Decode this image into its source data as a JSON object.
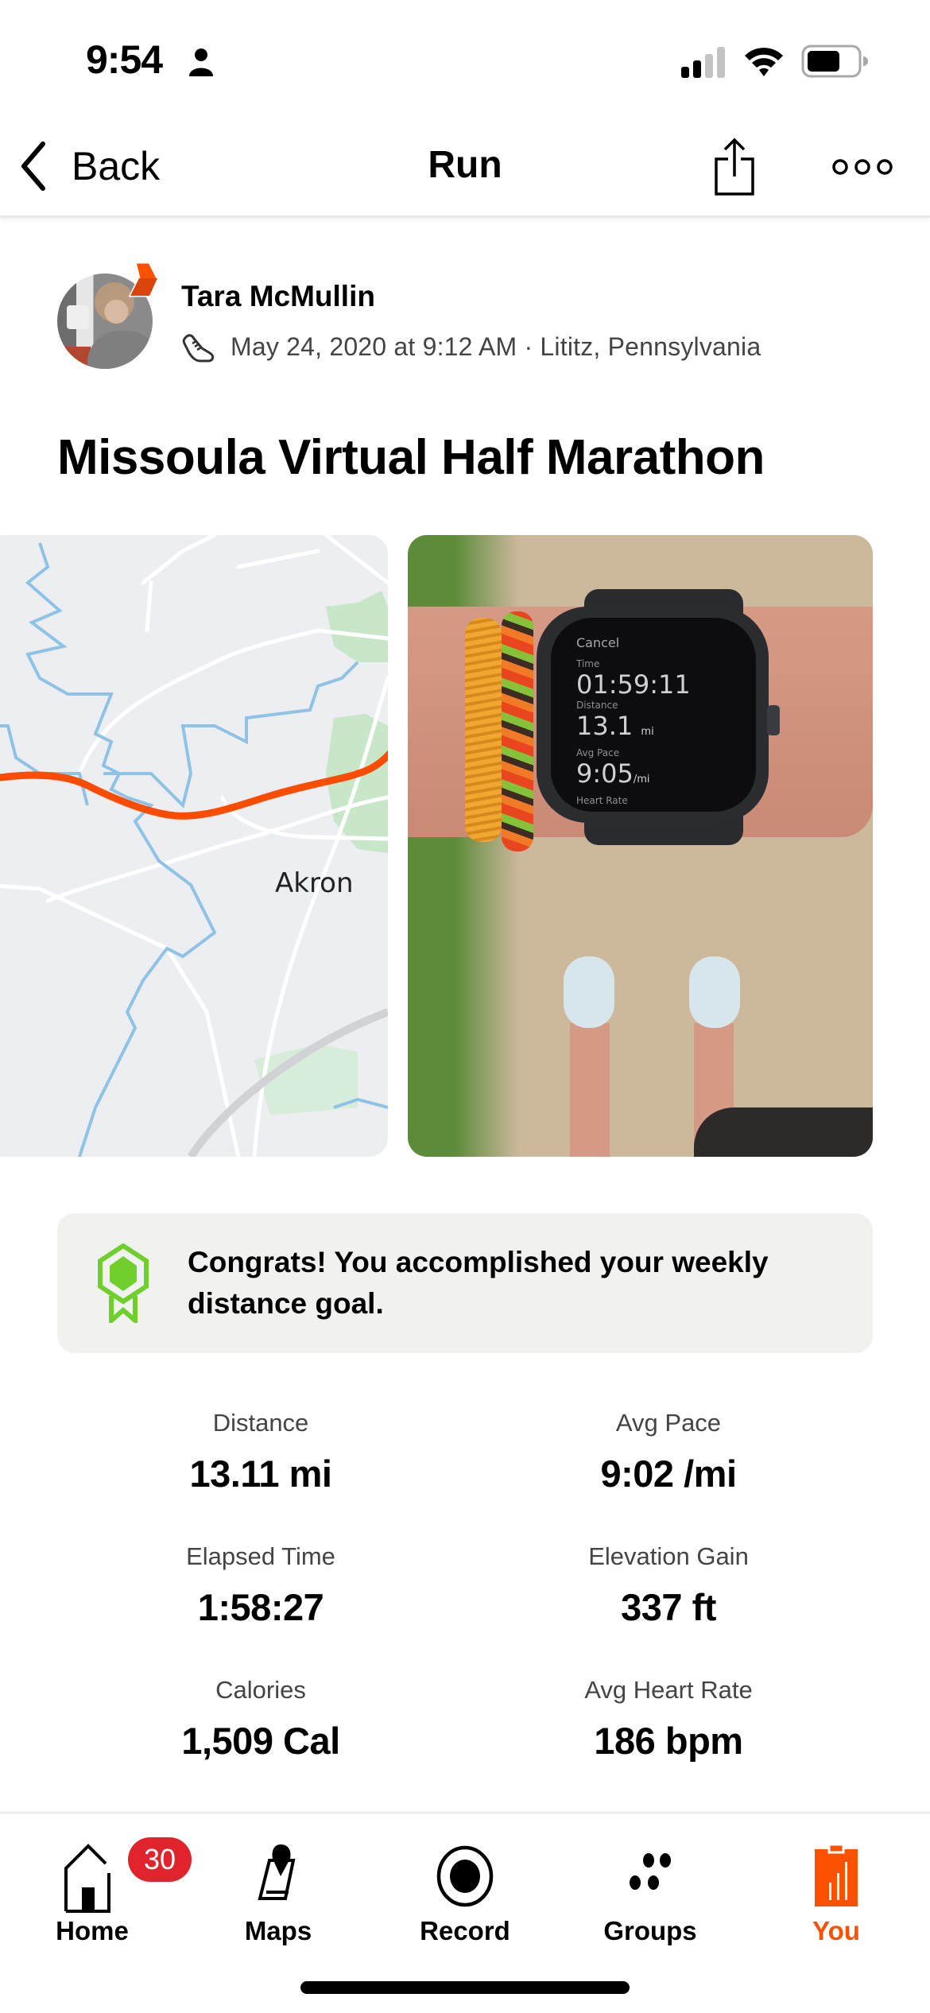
{
  "status_bar": {
    "time": "9:54",
    "icons": [
      "person-icon",
      "cellular-signal-icon",
      "wifi-icon",
      "battery-icon"
    ]
  },
  "nav": {
    "back_label": "Back",
    "title": "Run",
    "icons": [
      "chevron-left-icon",
      "share-icon",
      "more-icon"
    ]
  },
  "athlete": {
    "name": "Tara McMullin",
    "activity_meta": "May 24, 2020 at 9:12 AM · Lititz, Pennsylvania",
    "icons": [
      "subscriber-badge-icon",
      "shoe-icon"
    ]
  },
  "activity": {
    "title": "Missoula Virtual Half Marathon"
  },
  "media": {
    "map_label": "Akron",
    "watch": {
      "cancel": "Cancel",
      "time_label": "Time",
      "time_value": "01:59:11",
      "distance_label": "Distance",
      "distance_value": "13.1",
      "distance_unit": "mi",
      "pace_label": "Avg Pace",
      "pace_value": "9:05",
      "pace_unit": "/mi",
      "hr_label": "Heart Rate"
    }
  },
  "goal": {
    "text": "Congrats! You accomplished your weekly distance goal.",
    "icon": "goal-badge-icon"
  },
  "stats": [
    {
      "label": "Distance",
      "value": "13.11 mi"
    },
    {
      "label": "Avg Pace",
      "value": "9:02 /mi"
    },
    {
      "label": "Elapsed Time",
      "value": "1:58:27"
    },
    {
      "label": "Elevation Gain",
      "value": "337 ft"
    },
    {
      "label": "Calories",
      "value": "1,509 Cal"
    },
    {
      "label": "Avg Heart Rate",
      "value": "186 bpm"
    }
  ],
  "tabs": [
    {
      "label": "Home",
      "badge": "30",
      "icon": "home-icon"
    },
    {
      "label": "Maps",
      "icon": "maps-icon"
    },
    {
      "label": "Record",
      "icon": "record-icon"
    },
    {
      "label": "Groups",
      "icon": "groups-icon"
    },
    {
      "label": "You",
      "icon": "you-icon",
      "active": true
    }
  ],
  "colors": {
    "brand": "#fc5200",
    "route": "#fc4c02",
    "badge": "#e0242b",
    "goal_green": "#6fcf2c",
    "goal_card_bg": "#f1f1f0"
  }
}
